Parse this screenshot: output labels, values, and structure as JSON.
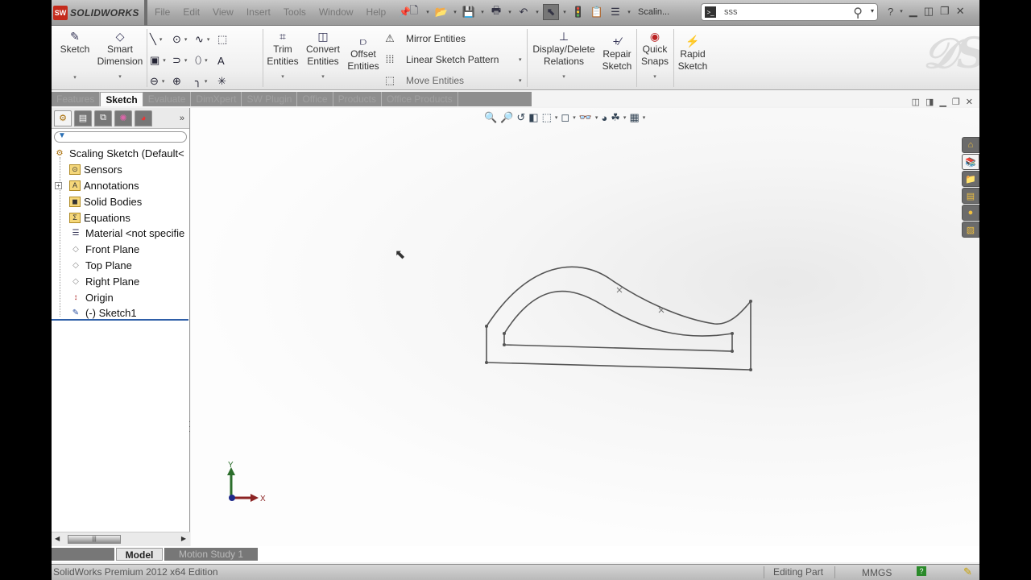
{
  "app": {
    "brand": "SOLIDWORKS",
    "brand_badge": "SW",
    "menu": [
      "File",
      "Edit",
      "View",
      "Insert",
      "Tools",
      "Window",
      "Help"
    ],
    "document_name": "Scalin...",
    "search": {
      "value": "sss",
      "placeholder": ""
    },
    "window_controls": [
      "help",
      "minimize",
      "tile",
      "restore",
      "close"
    ]
  },
  "quick_access": [
    {
      "icon": "new-document-icon",
      "glyph": "🗋",
      "has_dropdown": true
    },
    {
      "icon": "open-folder-icon",
      "glyph": "📂",
      "has_dropdown": true
    },
    {
      "icon": "save-icon",
      "glyph": "💾",
      "has_dropdown": true
    },
    {
      "icon": "print-icon",
      "glyph": "🖶",
      "has_dropdown": true
    },
    {
      "icon": "undo-icon",
      "glyph": "↶",
      "has_dropdown": true
    },
    {
      "icon": "select-pointer-icon",
      "glyph": "⬉",
      "has_dropdown": true
    },
    {
      "icon": "rebuild-traffic-light-icon",
      "glyph": "🚦",
      "has_dropdown": false
    },
    {
      "icon": "file-properties-icon",
      "glyph": "📋",
      "has_dropdown": false
    },
    {
      "icon": "options-icon",
      "glyph": "☰",
      "has_dropdown": true
    }
  ],
  "ribbon": {
    "sketch": "Sketch",
    "smart_dimension": [
      "Smart",
      "Dimension"
    ],
    "trim": [
      "Trim",
      "Entities"
    ],
    "convert": [
      "Convert",
      "Entities"
    ],
    "offset": [
      "Offset",
      "Entities"
    ],
    "mirror": "Mirror Entities",
    "linear_pattern": "Linear Sketch Pattern",
    "move": "Move Entities",
    "display_delete": [
      "Display/Delete",
      "Relations"
    ],
    "repair": [
      "Repair",
      "Sketch"
    ],
    "quick_snaps": [
      "Quick",
      "Snaps"
    ],
    "rapid_sketch": [
      "Rapid",
      "Sketch"
    ],
    "sketch_tools": [
      {
        "name": "line-icon",
        "glyph": "╲",
        "dd": true
      },
      {
        "name": "circle-icon",
        "glyph": "⊙",
        "dd": true
      },
      {
        "name": "spline-icon",
        "glyph": "∿",
        "dd": true
      },
      {
        "name": "construction-geometry-icon",
        "glyph": "⬚",
        "dd": false
      },
      {
        "name": "rectangle-icon",
        "glyph": "▣",
        "dd": true
      },
      {
        "name": "arc-icon",
        "glyph": "⊃",
        "dd": true
      },
      {
        "name": "ellipse-icon",
        "glyph": "⬯",
        "dd": true
      },
      {
        "name": "text-icon",
        "glyph": "A",
        "dd": false
      },
      {
        "name": "slot-icon",
        "glyph": "⊖",
        "dd": true
      },
      {
        "name": "polygon-icon",
        "glyph": "⊕",
        "dd": false
      },
      {
        "name": "fillet-icon",
        "glyph": "╮",
        "dd": true
      },
      {
        "name": "point-icon",
        "glyph": "✳",
        "dd": false
      }
    ]
  },
  "command_tabs": [
    {
      "label": "Features",
      "active": false
    },
    {
      "label": "Sketch",
      "active": true
    },
    {
      "label": "Evaluate",
      "active": false
    },
    {
      "label": "DimXpert",
      "active": false
    },
    {
      "label": "SW Plugin",
      "active": false
    },
    {
      "label": "Office",
      "active": false
    },
    {
      "label": "Products",
      "active": false
    },
    {
      "label": "Office Products",
      "active": false
    }
  ],
  "feature_manager": {
    "tabs": [
      "featuremanager-tree",
      "propertymanager",
      "configurationmanager",
      "dimxpertmanager",
      "display-manager"
    ],
    "more": "»",
    "root": "Scaling Sketch  (Default<",
    "items": [
      {
        "label": "Sensors",
        "icon": "sensors-folder-icon",
        "glyph": "⊙",
        "expandable": false
      },
      {
        "label": "Annotations",
        "icon": "annotations-folder-icon",
        "glyph": "A",
        "expandable": true
      },
      {
        "label": "Solid Bodies",
        "icon": "solid-bodies-folder-icon",
        "glyph": "◼",
        "expandable": false
      },
      {
        "label": "Equations",
        "icon": "equations-folder-icon",
        "glyph": "Σ",
        "expandable": false
      },
      {
        "label": "Material <not specifie",
        "icon": "material-icon",
        "glyph": "☰",
        "expandable": false
      },
      {
        "label": "Front Plane",
        "icon": "plane-icon",
        "glyph": "◇",
        "expandable": false
      },
      {
        "label": "Top Plane",
        "icon": "plane-icon",
        "glyph": "◇",
        "expandable": false
      },
      {
        "label": "Right Plane",
        "icon": "plane-icon",
        "glyph": "◇",
        "expandable": false
      },
      {
        "label": "Origin",
        "icon": "origin-icon",
        "glyph": "↕",
        "expandable": false
      },
      {
        "label": "(-) Sketch1",
        "icon": "sketch-icon",
        "glyph": "✎",
        "expandable": false
      }
    ]
  },
  "graphics": {
    "headsup_tools": [
      {
        "name": "zoom-to-fit-icon",
        "glyph": "🔍",
        "dd": false
      },
      {
        "name": "zoom-to-area-icon",
        "glyph": "🔎",
        "dd": false
      },
      {
        "name": "previous-view-icon",
        "glyph": "↺",
        "dd": false
      },
      {
        "name": "section-view-icon",
        "glyph": "◧",
        "dd": false
      },
      {
        "name": "view-orientation-icon",
        "glyph": "⬚",
        "dd": true
      },
      {
        "name": "display-style-icon",
        "glyph": "◻",
        "dd": true
      },
      {
        "name": "hide-show-items-icon",
        "glyph": "👓",
        "dd": true
      },
      {
        "name": "edit-appearance-icon",
        "glyph": "◕",
        "dd": false
      },
      {
        "name": "apply-scene-icon",
        "glyph": "☘",
        "dd": true
      },
      {
        "name": "view-settings-icon",
        "glyph": "▦",
        "dd": true
      }
    ],
    "task_pane": [
      {
        "name": "solidworks-resources-icon",
        "glyph": "⌂",
        "active": false
      },
      {
        "name": "design-library-icon",
        "glyph": "📚",
        "active": true
      },
      {
        "name": "file-explorer-icon",
        "glyph": "📁",
        "active": false
      },
      {
        "name": "view-palette-icon",
        "glyph": "▤",
        "active": false
      },
      {
        "name": "appearances-scenes-icon",
        "glyph": "●",
        "active": false
      },
      {
        "name": "custom-properties-icon",
        "glyph": "▧",
        "active": false
      }
    ],
    "triad": {
      "x_label": "X",
      "y_label": "Y"
    }
  },
  "bottom_tabs": [
    {
      "label": "Model",
      "active": true
    },
    {
      "label": "Motion Study 1",
      "active": false
    }
  ],
  "status": {
    "edition": "SolidWorks Premium 2012 x64 Edition",
    "mode": "Editing Part",
    "units": "MMGS",
    "help_badge": "?"
  }
}
